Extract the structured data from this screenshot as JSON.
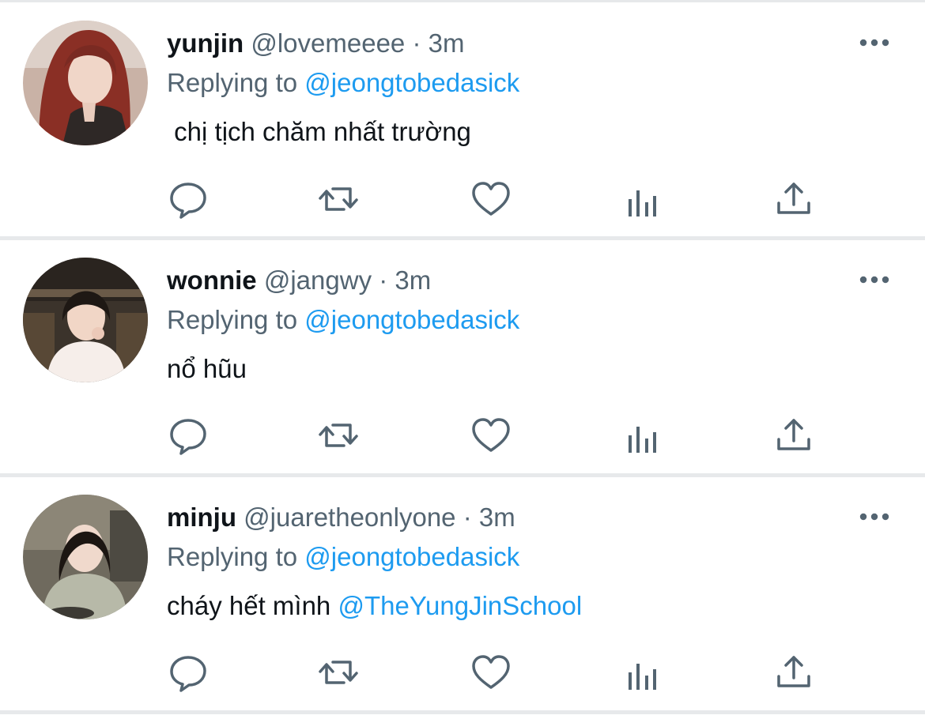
{
  "colors": {
    "text": "#0f1419",
    "muted": "#536471",
    "link": "#1d9bf0",
    "divider": "#e7e9eb",
    "background": "#ffffff"
  },
  "actions": [
    {
      "name": "reply",
      "icon": "comment-icon"
    },
    {
      "name": "retweet",
      "icon": "retweet-icon"
    },
    {
      "name": "like",
      "icon": "heart-icon"
    },
    {
      "name": "analytics",
      "icon": "bar-chart-icon"
    },
    {
      "name": "share",
      "icon": "share-icon"
    }
  ],
  "tweets": [
    {
      "display_name": "yunjin",
      "handle": "@lovemeeee",
      "separator": "·",
      "time": "3m",
      "replying_prefix": "Replying to",
      "replying_to": "@jeongtobedasick",
      "text": " chị tịch chăm nhất trường",
      "mention": "",
      "more_icon": "more-options-icon"
    },
    {
      "display_name": "wonnie",
      "handle": "@jangwy",
      "separator": "·",
      "time": "3m",
      "replying_prefix": "Replying to",
      "replying_to": "@jeongtobedasick",
      "text": "nổ hũu",
      "mention": "",
      "more_icon": "more-options-icon"
    },
    {
      "display_name": "minju",
      "handle": "@juaretheonlyone",
      "separator": "·",
      "time": "3m",
      "replying_prefix": "Replying to",
      "replying_to": "@jeongtobedasick",
      "text": "cháy hết mình ",
      "mention": "@TheYungJinSchool",
      "more_icon": "more-options-icon"
    }
  ]
}
